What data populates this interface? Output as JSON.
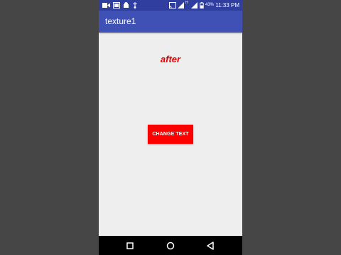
{
  "status_bar": {
    "time": "11:33 PM",
    "battery_percent": "43%",
    "sim_label": "H"
  },
  "app_bar": {
    "title": "texture1"
  },
  "content": {
    "label_text": "after",
    "label_color": "#e00000",
    "button_label": "CHANGE TEXT",
    "button_color": "#ff0000"
  },
  "colors": {
    "status_bar": "#303f9f",
    "app_bar": "#3f51b5",
    "background": "#eeeeee",
    "outer_background": "#464646"
  },
  "nav_bar": {
    "icons": [
      "recent-apps-icon",
      "home-icon",
      "back-icon"
    ]
  }
}
